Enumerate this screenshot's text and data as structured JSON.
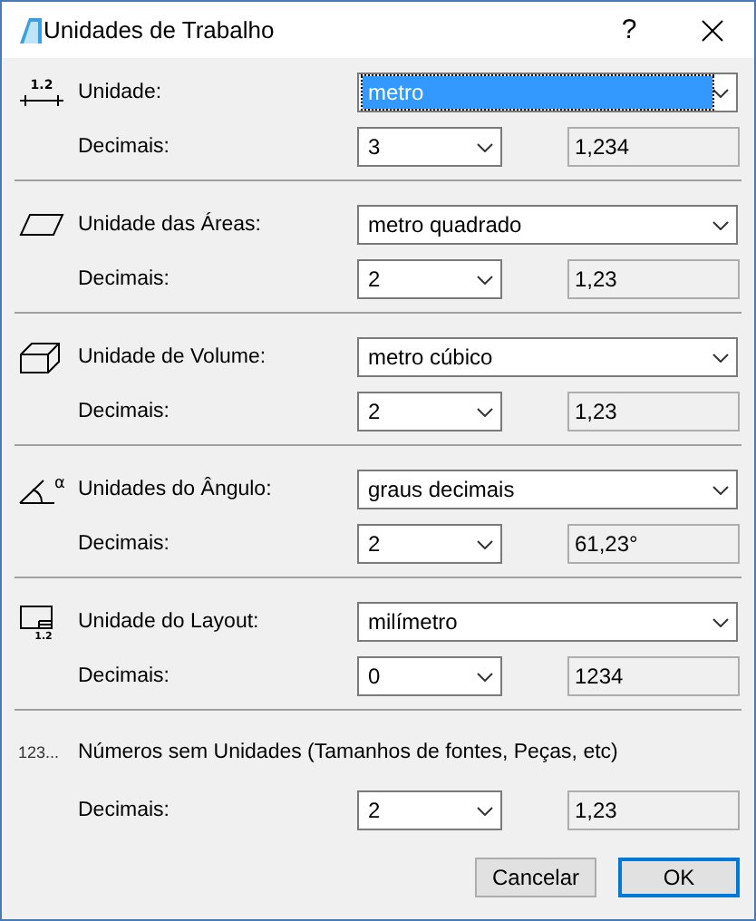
{
  "window": {
    "title": "Unidades de Trabalho",
    "help": "?"
  },
  "sections": [
    {
      "kind": "length",
      "icon_text": "1.2",
      "label": "Unidade:",
      "unit": "metro",
      "focused": true,
      "decimals_label": "Decimais:",
      "decimals": "3",
      "preview": "1,234"
    },
    {
      "kind": "area",
      "label": "Unidade das Áreas:",
      "unit": "metro quadrado",
      "focused": false,
      "decimals_label": "Decimais:",
      "decimals": "2",
      "preview": "1,23"
    },
    {
      "kind": "volume",
      "label": "Unidade de Volume:",
      "unit": "metro cúbico",
      "focused": false,
      "decimals_label": "Decimais:",
      "decimals": "2",
      "preview": "1,23"
    },
    {
      "kind": "angle",
      "icon_text": "α",
      "label": "Unidades do Ângulo:",
      "unit": "graus decimais",
      "focused": false,
      "decimals_label": "Decimais:",
      "decimals": "2",
      "preview": "61,23°"
    },
    {
      "kind": "layout",
      "icon_text": "1.2",
      "label": "Unidade do Layout:",
      "unit": "milímetro",
      "focused": false,
      "decimals_label": "Decimais:",
      "decimals": "0",
      "preview": "1234"
    },
    {
      "kind": "number",
      "icon_text": "123...",
      "label": "Números sem Unidades (Tamanhos de fontes, Peças, etc)",
      "decimals_label": "Decimais:",
      "decimals": "2",
      "preview": "1,23"
    }
  ],
  "buttons": [
    {
      "label": "Cancelar",
      "default": false
    },
    {
      "label": "OK",
      "default": true
    }
  ]
}
